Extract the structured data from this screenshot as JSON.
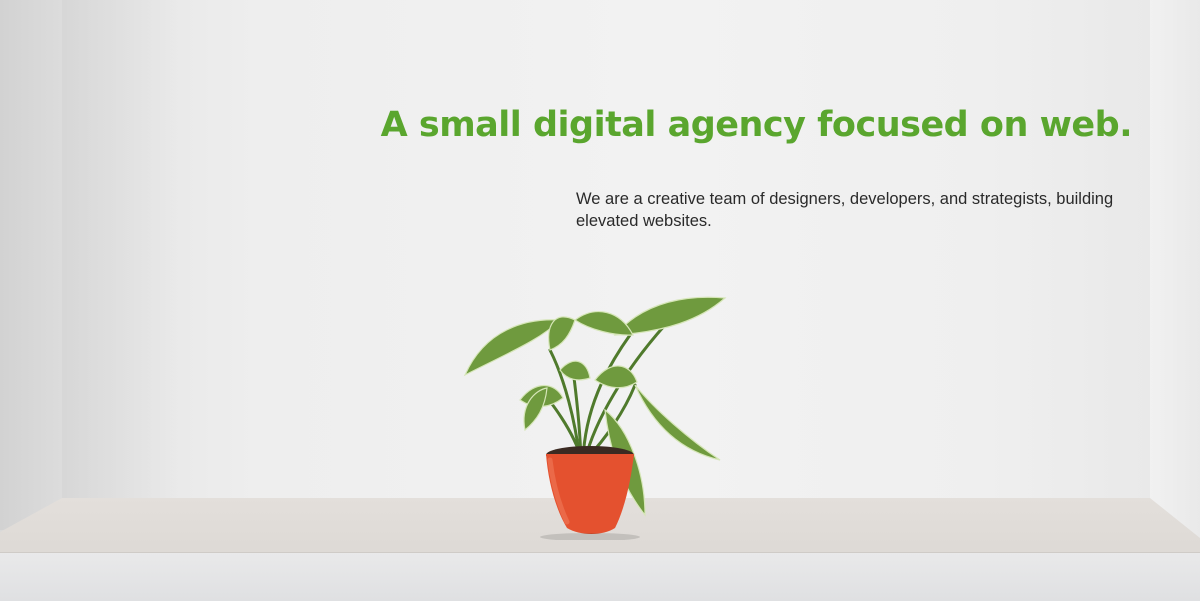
{
  "hero": {
    "headline": "A small digital agency focused on web.",
    "subtext": "We are a creative team of designers, developers, and strategists, building elevated websites."
  },
  "colors": {
    "accent": "#5aa62e",
    "wall": "#f0f0f0",
    "pot": "#e4512f",
    "leaf": "#6f9a3e"
  },
  "image": {
    "subject": "potted-plant-on-ledge"
  }
}
